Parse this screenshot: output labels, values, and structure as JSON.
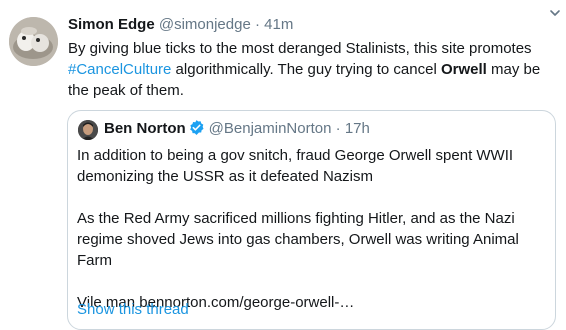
{
  "tweet": {
    "author_name": "Simon Edge",
    "handle": "@simonjedge",
    "separator": "·",
    "time": "41m",
    "text_part1": "By giving blue ticks to the most deranged Stalinists, this site promotes ",
    "hashtag": "#CancelCulture",
    "text_part2": " algorithmically. The guy trying to cancel ",
    "bold_word": "Orwell",
    "text_part3": " may be the peak of them.",
    "more_icon": "chevron-down-icon"
  },
  "quoted": {
    "author_name": "Ben Norton",
    "verified_icon": "verified-badge-icon",
    "handle": "@BenjaminNorton",
    "separator": "·",
    "time": "17h",
    "paragraph1": "In addition to being a gov snitch, fraud George Orwell spent WWII demonizing the USSR as it defeated Nazism",
    "paragraph2": "As the Red Army sacrificed millions fighting Hitler, and as the Nazi regime shoved Jews into gas chambers, Orwell was writing Animal Farm",
    "paragraph3": "Vile man bennorton.com/george-orwell-…",
    "show_thread": "Show this thread"
  },
  "colors": {
    "link": "#1b95e0",
    "muted": "#657786",
    "border": "#ccd6dd",
    "text": "#14171a"
  }
}
